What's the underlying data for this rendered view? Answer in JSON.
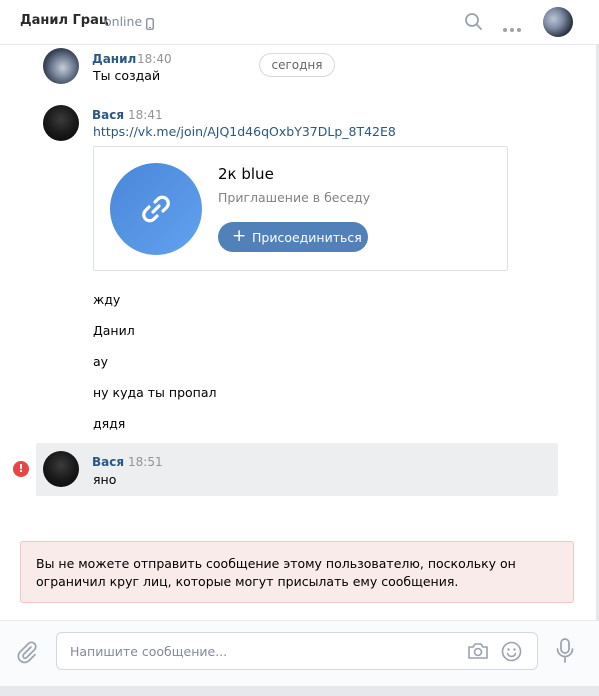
{
  "header": {
    "title": "Данил Грац",
    "status": "online"
  },
  "date_separator": "сегодня",
  "messages": [
    {
      "name": "Данил",
      "time": "18:40",
      "text": "Ты создай"
    },
    {
      "name": "Вася",
      "time": "18:41",
      "link": "https://vk.me/join/AJQ1d46qOxbY37DLp_8T42E8"
    }
  ],
  "invite_card": {
    "title": "2к blue",
    "subtitle": "Приглашение в беседу",
    "join_label": "Присоединиться"
  },
  "followups": [
    "жду",
    "Данил",
    "ау",
    "ну куда ты пропал",
    "дядя"
  ],
  "failed_message": {
    "name": "Вася",
    "time": "18:51",
    "text": "яно",
    "error_mark": "!"
  },
  "warning": "Вы не можете отправить сообщение этому пользователю, поскольку он ограничил круг лиц, которые могут присылать ему сообщения.",
  "composer": {
    "placeholder": "Напишите сообщение..."
  }
}
